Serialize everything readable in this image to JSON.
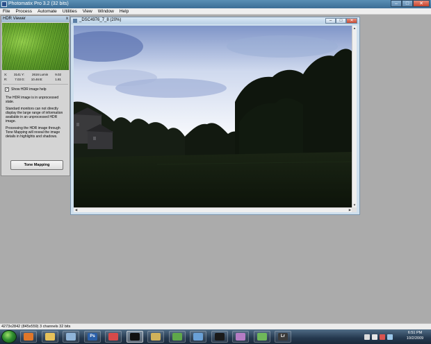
{
  "app": {
    "title": "Photomatix Pro 3.2 (32 bits)"
  },
  "window_controls": {
    "minimize": "–",
    "maximize": "□",
    "close": "✕"
  },
  "menu": [
    "File",
    "Process",
    "Automate",
    "Utilities",
    "View",
    "Window",
    "Help"
  ],
  "hdr_viewer": {
    "title": "HDR Viewer",
    "close": "x",
    "readout": [
      {
        "k1": "X:",
        "v1": "3141",
        "k2": "Y:",
        "v2": "2616",
        "k3": "Lumin",
        "v3": "9.02"
      },
      {
        "k1": "R:",
        "v1": "7.03",
        "k2": "G:",
        "v2": "10.46",
        "k3": "B:",
        "v3": "1.81"
      }
    ],
    "show_help_label": "Show HDR image help",
    "show_help_checked": true,
    "help_paragraphs": [
      "The HDR image is in unprocessed state.",
      "Standard monitors can not directly display the large range of information available in an unprocessed HDR image.",
      "Processing the HDR image through Tone Mapping will reveal the image details in highlights and shadows."
    ],
    "tone_mapping_button": "Tone Mapping"
  },
  "document": {
    "title": "_DSC4976_7_8 (20%)"
  },
  "statusbar": {
    "text": "4273x2842 (845x559) 3 channels 32 bits"
  },
  "taskbar": {
    "apps": [
      {
        "name": "firefox",
        "color": "#e0772a"
      },
      {
        "name": "explorer",
        "color": "#e6c25a"
      },
      {
        "name": "media-player",
        "color": "#8fb4d8"
      },
      {
        "name": "photoshop",
        "color": "#2a5fa8",
        "label": "Ps"
      },
      {
        "name": "app-5",
        "color": "#d64a4a"
      },
      {
        "name": "photomatix",
        "color": "#111111",
        "active": true
      },
      {
        "name": "app-7",
        "color": "#d0b25a"
      },
      {
        "name": "app-8",
        "color": "#5fa84a"
      },
      {
        "name": "app-9",
        "color": "#6aa0d6"
      },
      {
        "name": "app-10",
        "color": "#1a1a1a"
      },
      {
        "name": "app-11",
        "color": "#b57cc4"
      },
      {
        "name": "app-12",
        "color": "#6fb85a"
      },
      {
        "name": "lightroom",
        "color": "#3a3a3a",
        "label": "Lr"
      }
    ],
    "clock_time": "6:51 PM",
    "clock_date": "10/2/2009"
  }
}
